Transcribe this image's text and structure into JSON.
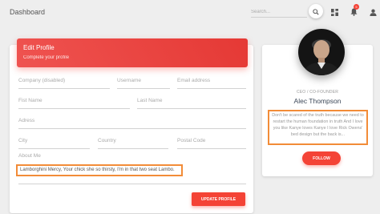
{
  "topbar": {
    "brand": "Dashboard",
    "search_placeholder": "Search...",
    "notification_count": "5"
  },
  "edit_profile": {
    "title": "Edit Profile",
    "subtitle": "Complete your profile",
    "fields": {
      "company": "Company (disabled)",
      "username": "Username",
      "email": "Email address",
      "first_name": "Fist Name",
      "last_name": "Last Name",
      "address": "Adress",
      "city": "City",
      "country": "Country",
      "postal_code": "Postal Code"
    },
    "about_label": "About Me",
    "about_text": "Lamborghini Mercy, Your chick she so thirsty, I'm in that two seat Lambo.",
    "update_label": "UPDATE PROFILE"
  },
  "profile": {
    "role": "CEO / CO-FOUNDER",
    "name": "Alec Thompson",
    "bio": "Don't be scared of the truth because we need to restart the human foundation in truth And I love you like Kanye loves Kanye I love Rick Owens' bed design but the back is...",
    "follow_label": "FOLLOW"
  },
  "colors": {
    "accent": "#f44336",
    "highlight_border": "#f28c38"
  },
  "icons": [
    "search-icon",
    "dashboard-grid-icon",
    "notifications-icon",
    "person-icon"
  ]
}
